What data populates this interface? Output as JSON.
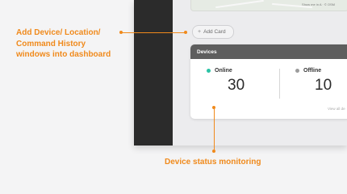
{
  "map": {
    "credit": "Show me in A · © OSM"
  },
  "add_card": {
    "icon": "plus-icon",
    "label": "Add Card"
  },
  "devices_card": {
    "title": "Devices",
    "online": {
      "label": "Online",
      "value": "30",
      "status_color": "#2bc3a5"
    },
    "offline": {
      "label": "Offline",
      "value": "10",
      "status_color": "#9c9c9c"
    },
    "view_all": "View all de"
  },
  "annotations": {
    "add_windows": [
      "Add Device/ Location/",
      "Command History",
      "windows into dashboard"
    ],
    "status_monitoring": "Device status monitoring",
    "accent_color": "#f08a1c"
  }
}
